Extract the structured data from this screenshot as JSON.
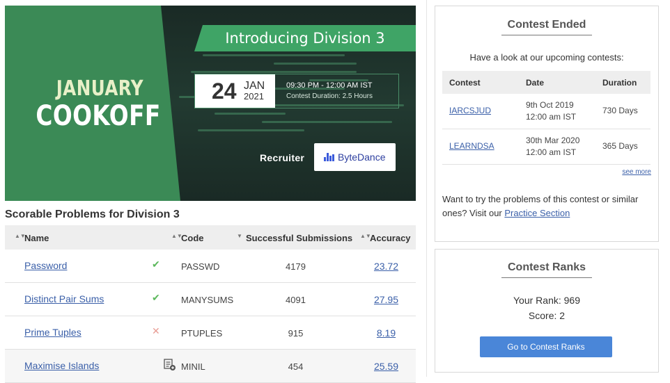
{
  "banner": {
    "title_line1": "JANUARY",
    "title_line2": "COOKOFF",
    "intro": "Introducing Division 3",
    "date_day": "24",
    "date_month": "JAN",
    "date_year": "2021",
    "time": "09:30 PM - 12:00 AM IST",
    "duration": "Contest Duration: 2.5 Hours",
    "recruiter_label": "Recruiter",
    "sponsor": "ByteDance"
  },
  "problems": {
    "title": "Scorable Problems for Division 3",
    "columns": {
      "name": "Name",
      "code": "Code",
      "successful": "Successful Submissions",
      "accuracy": "Accuracy"
    },
    "rows": [
      {
        "name": "Password",
        "status": "solved",
        "status_icon": "✔",
        "code": "PASSWD",
        "successful": "4179",
        "accuracy": "23.72"
      },
      {
        "name": "Distinct Pair Sums",
        "status": "solved",
        "status_icon": "✔",
        "code": "MANYSUMS",
        "successful": "4091",
        "accuracy": "27.95"
      },
      {
        "name": "Prime Tuples",
        "status": "wrong",
        "status_icon": "✕",
        "code": "PTUPLES",
        "successful": "915",
        "accuracy": "8.19"
      },
      {
        "name": "Maximise Islands",
        "status": "submitted",
        "status_icon": "document-icon",
        "code": "MINIL",
        "successful": "454",
        "accuracy": "25.59"
      }
    ]
  },
  "contest_ended": {
    "title": "Contest Ended",
    "subtitle": "Have a look at our upcoming contests:",
    "columns": {
      "contest": "Contest",
      "date": "Date",
      "duration": "Duration"
    },
    "rows": [
      {
        "contest": "IARCSJUD",
        "date_line1": "9th Oct 2019",
        "date_line2": "12:00 am IST",
        "duration": "730 Days"
      },
      {
        "contest": "LEARNDSA",
        "date_line1": "30th Mar 2020",
        "date_line2": "12:00 am IST",
        "duration": "365 Days"
      }
    ],
    "see_more": "see more",
    "practice_text": "Want to try the problems of this contest or similar ones? Visit our",
    "practice_link": "Practice Section"
  },
  "contest_ranks": {
    "title": "Contest Ranks",
    "your_rank": "Your Rank: 969",
    "score": "Score: 2",
    "button": "Go to Contest Ranks"
  },
  "colors": {
    "banner_green": "#3b8a56",
    "link_blue": "#3a5fa8",
    "button_blue": "#4a86d8",
    "solved_green": "#5cb85c",
    "wrong_red": "#e89d95"
  }
}
